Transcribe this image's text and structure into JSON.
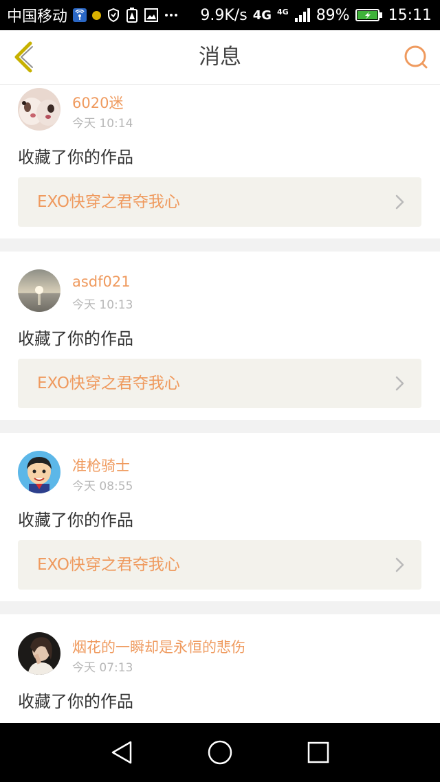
{
  "status_bar": {
    "carrier": "中国移动",
    "speed": "9.9K/s",
    "network": "4G",
    "network_small": "4G",
    "battery_percent": "89%",
    "time": "15:11",
    "icons": [
      "wifi-hotspot-icon",
      "notification-dot-icon",
      "vpn-shield-icon",
      "battery-saver-icon",
      "image-icon",
      "more-icon",
      "signal-icon",
      "battery-icon"
    ]
  },
  "header": {
    "title": "消息",
    "back_icon": "back-chevron-icon",
    "search_icon": "search-icon"
  },
  "colors": {
    "accent": "#ef9a5e",
    "back_icon": "#c7b100",
    "card_bg": "#ffffff",
    "link_bg": "#f3f2ec",
    "page_bg": "#f2f2f2"
  },
  "messages": [
    {
      "username": "6020迷",
      "time": "今天 10:14",
      "action": "收藏了你的作品",
      "work_title": "EXO快穿之君夺我心"
    },
    {
      "username": "asdf021",
      "time": "今天 10:13",
      "action": "收藏了你的作品",
      "work_title": "EXO快穿之君夺我心"
    },
    {
      "username": "准枪骑士",
      "time": "今天 08:55",
      "action": "收藏了你的作品",
      "work_title": "EXO快穿之君夺我心"
    },
    {
      "username": "烟花的一瞬却是永恒的悲伤",
      "time": "今天 07:13",
      "action": "收藏了你的作品"
    }
  ],
  "nav_bar": {
    "icons": [
      "back-triangle-icon",
      "home-circle-icon",
      "recents-square-icon"
    ]
  }
}
